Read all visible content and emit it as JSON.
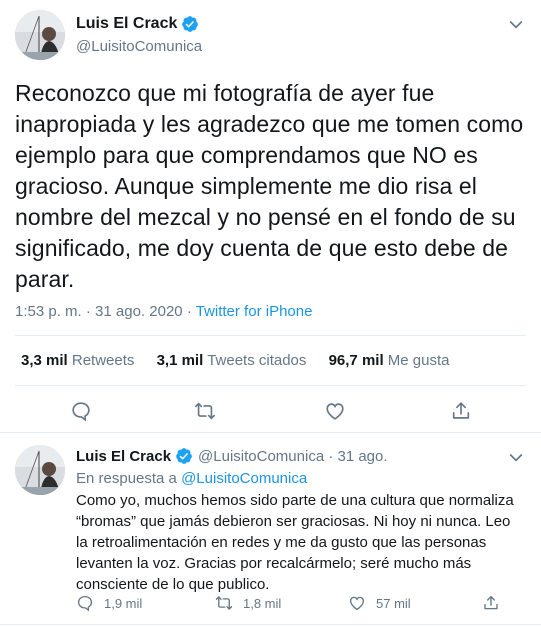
{
  "main_tweet": {
    "display_name": "Luis El Crack",
    "handle": "@LuisitoComunica",
    "text_lines": [
      "Reconozco que mi fotografía de ayer fue",
      "inapropiada y les agradezco que me tomen como",
      "ejemplo para que comprendamos que NO es",
      "gracioso. Aunque simplemente me dio risa el",
      "nombre del mezcal y no pensé en el fondo de su",
      "significado, me doy cuenta de que esto debe de",
      "parar."
    ],
    "time": "1:53 p. m.",
    "separator": "·",
    "date": "31 ago. 2020",
    "source": "Twitter for iPhone",
    "stats": {
      "retweets_count": "3,3 mil",
      "retweets_label": "Retweets",
      "quotes_count": "3,1 mil",
      "quotes_label": "Tweets citados",
      "likes_count": "96,7 mil",
      "likes_label": "Me gusta"
    }
  },
  "reply_tweet": {
    "display_name": "Luis El Crack",
    "handle_time": "@LuisitoComunica · 31 ago.",
    "reply_prefix": "En respuesta a",
    "reply_handle": "@LuisitoComunica",
    "text_lines": [
      "Como yo, muchos hemos sido parte de una cultura que normaliza",
      "“bromas” que jamás debieron ser graciosas. Ni hoy ni nunca. Leo",
      "la retroalimentación en redes y me da gusto que las personas",
      "levanten la voz. Gracias por recalcármelo; seré mucho más",
      "consciente de lo que publico."
    ],
    "reply_count": "1,9 mil",
    "retweet_count": "1,8 mil",
    "like_count": "57 mil"
  },
  "colors": {
    "text": "#14171a",
    "secondary": "#657786",
    "link": "#1b95e0",
    "verified": "#1da1f2",
    "divider": "#e6ecf0"
  },
  "icons": [
    "verified-badge-icon",
    "chevron-down-icon",
    "reply-icon",
    "retweet-icon",
    "like-icon",
    "share-icon"
  ]
}
